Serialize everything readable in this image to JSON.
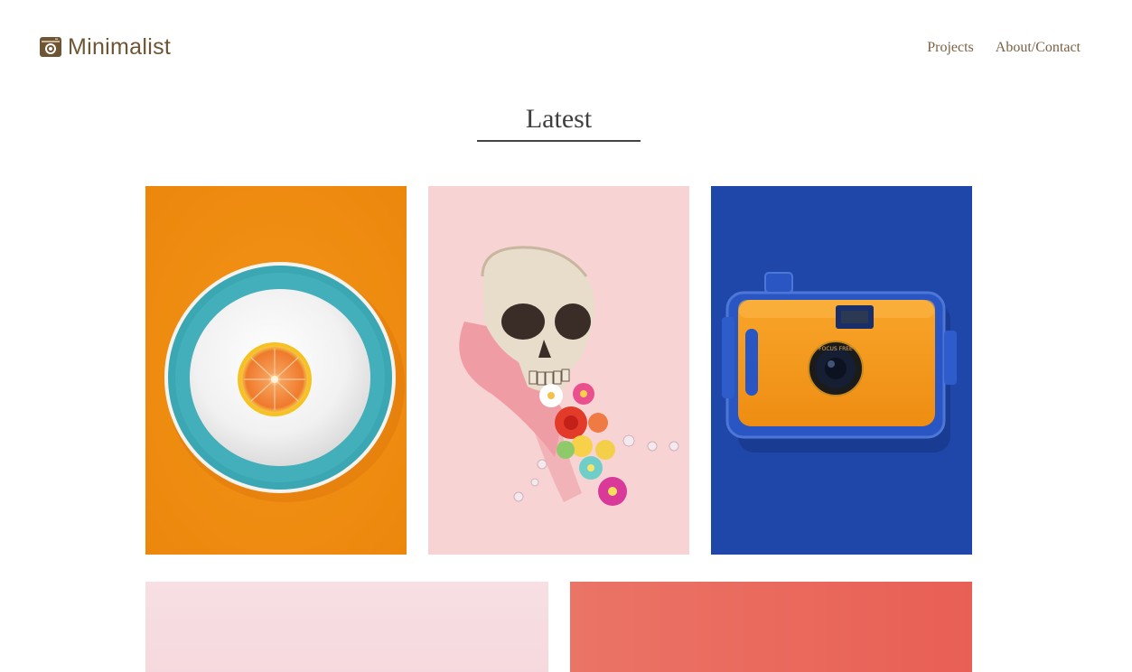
{
  "header": {
    "brand_name": "Minimalist",
    "brand_icon": "camera-icon",
    "nav": [
      {
        "label": "Projects"
      },
      {
        "label": "About/Contact"
      }
    ]
  },
  "main": {
    "section_title": "Latest"
  },
  "colors": {
    "brand": "#6e5634",
    "orange_tile": "#ee8a0e",
    "pink_tile": "#f8d3d3",
    "blue_tile": "#2149ad",
    "light_pink_tile": "#f7dfe3",
    "coral_tile": "#ea6a5e"
  },
  "camera_lens_text": "FOCUS FREE"
}
